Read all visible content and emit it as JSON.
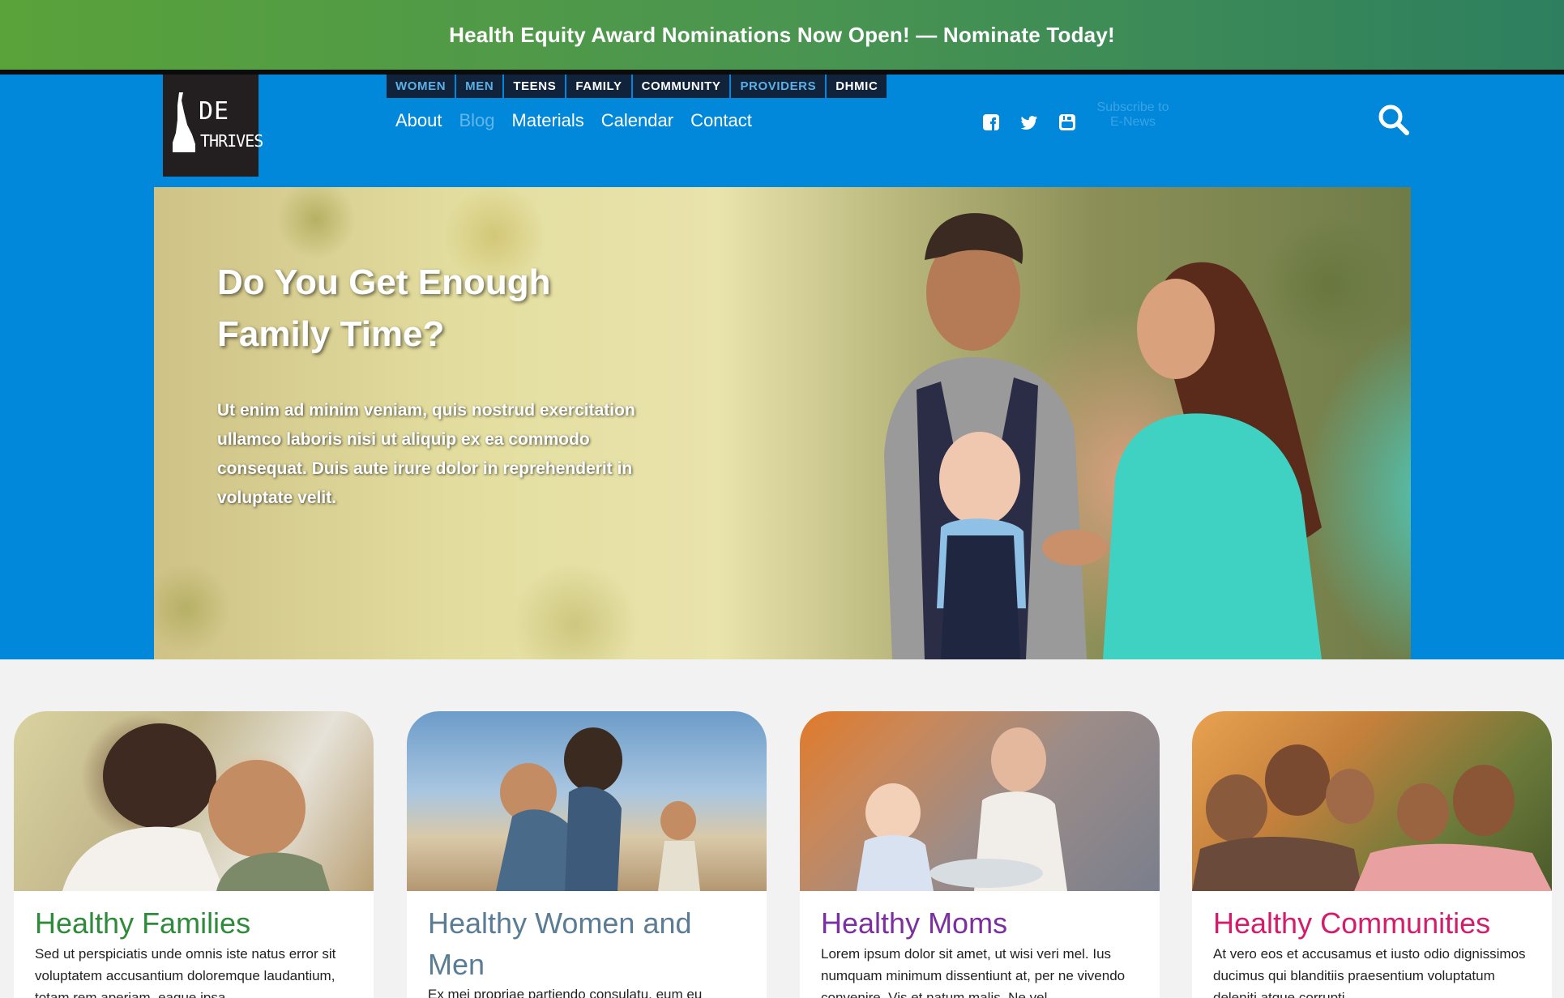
{
  "banner": {
    "text": "Health Equity Award Nominations Now Open! — Nominate Today!",
    "colors": {
      "start": "#5aa23a",
      "end": "#2d7f5f"
    }
  },
  "logo": {
    "line1": "DE",
    "line2": "THRIVES"
  },
  "audience_nav": {
    "items": [
      {
        "label": "WOMEN",
        "style": "dim"
      },
      {
        "label": "MEN",
        "style": "dim"
      },
      {
        "label": "TEENS",
        "style": "bright"
      },
      {
        "label": "FAMILY",
        "style": "bright"
      },
      {
        "label": "COMMUNITY",
        "style": "bright"
      },
      {
        "label": "PROVIDERS",
        "style": "dim"
      },
      {
        "label": "DHMIC",
        "style": "bright"
      }
    ]
  },
  "main_nav": {
    "items": [
      {
        "label": "About",
        "active": false
      },
      {
        "label": "Blog",
        "active": true
      },
      {
        "label": "Materials",
        "active": false
      },
      {
        "label": "Calendar",
        "active": false
      },
      {
        "label": "Contact",
        "active": false
      }
    ]
  },
  "social": {
    "icons": [
      "facebook-icon",
      "twitter-icon",
      "youtube-icon"
    ]
  },
  "subscribe": {
    "label": "Subscribe to E-News"
  },
  "search": {
    "icon": "search-icon"
  },
  "hero": {
    "title_line1": "Do You Get Enough",
    "title_line2": "Family Time?",
    "body": "Ut enim ad minim veniam, quis nostrud exercitation ullamco laboris nisi ut aliquip ex ea commodo consequat. Duis aute irure dolor in reprehenderit in voluptate velit."
  },
  "cards": [
    {
      "title": "Healthy Families",
      "color": "#2e8b3a",
      "text": "Sed ut perspiciatis unde omnis iste natus error sit voluptatem accusantium doloremque laudantium, totam rem aperiam, eaque ipsa"
    },
    {
      "title": "Healthy Women and Men",
      "color": "#5a7d95",
      "text": "Ex mei propriae partiendo consulatu, eum eu"
    },
    {
      "title": "Healthy Moms",
      "color": "#7b2fa0",
      "text": "Lorem ipsum dolor sit amet, ut wisi veri mel. Ius numquam minimum dissentiunt at, per ne vivendo convenire. Vis et natum malis. Ne vel"
    },
    {
      "title": "Healthy Communities",
      "color": "#d41c6b",
      "text": "At vero eos et accusamus et iusto odio dignissimos ducimus qui blanditiis praesentium voluptatum deleniti atque corrupti"
    }
  ],
  "colors": {
    "header_blue": "#0288da",
    "page_bg": "#f2f2f2"
  }
}
